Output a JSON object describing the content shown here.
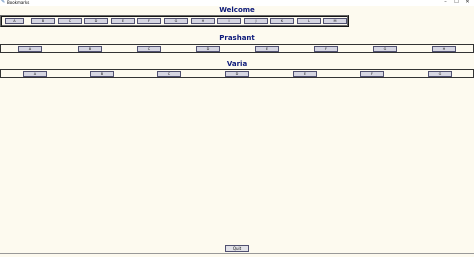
{
  "window": {
    "title": "Bookmarks",
    "minimize_glyph": "–",
    "maximize_glyph": "☐",
    "close_glyph": "✕",
    "icon": "feather-icon"
  },
  "sections": [
    {
      "heading": "Welcome",
      "buttons": [
        "A",
        "B",
        "C",
        "D",
        "E",
        "F",
        "G",
        "H",
        "I",
        "J",
        "K",
        "L",
        "M"
      ]
    },
    {
      "heading": "Prashant",
      "buttons": [
        "A",
        "B",
        "C",
        "D",
        "E",
        "F",
        "G",
        "H"
      ]
    },
    {
      "heading": "Varia",
      "buttons": [
        "A",
        "B",
        "C",
        "D",
        "E",
        "F",
        "G"
      ]
    }
  ],
  "quit_label": "Quit"
}
